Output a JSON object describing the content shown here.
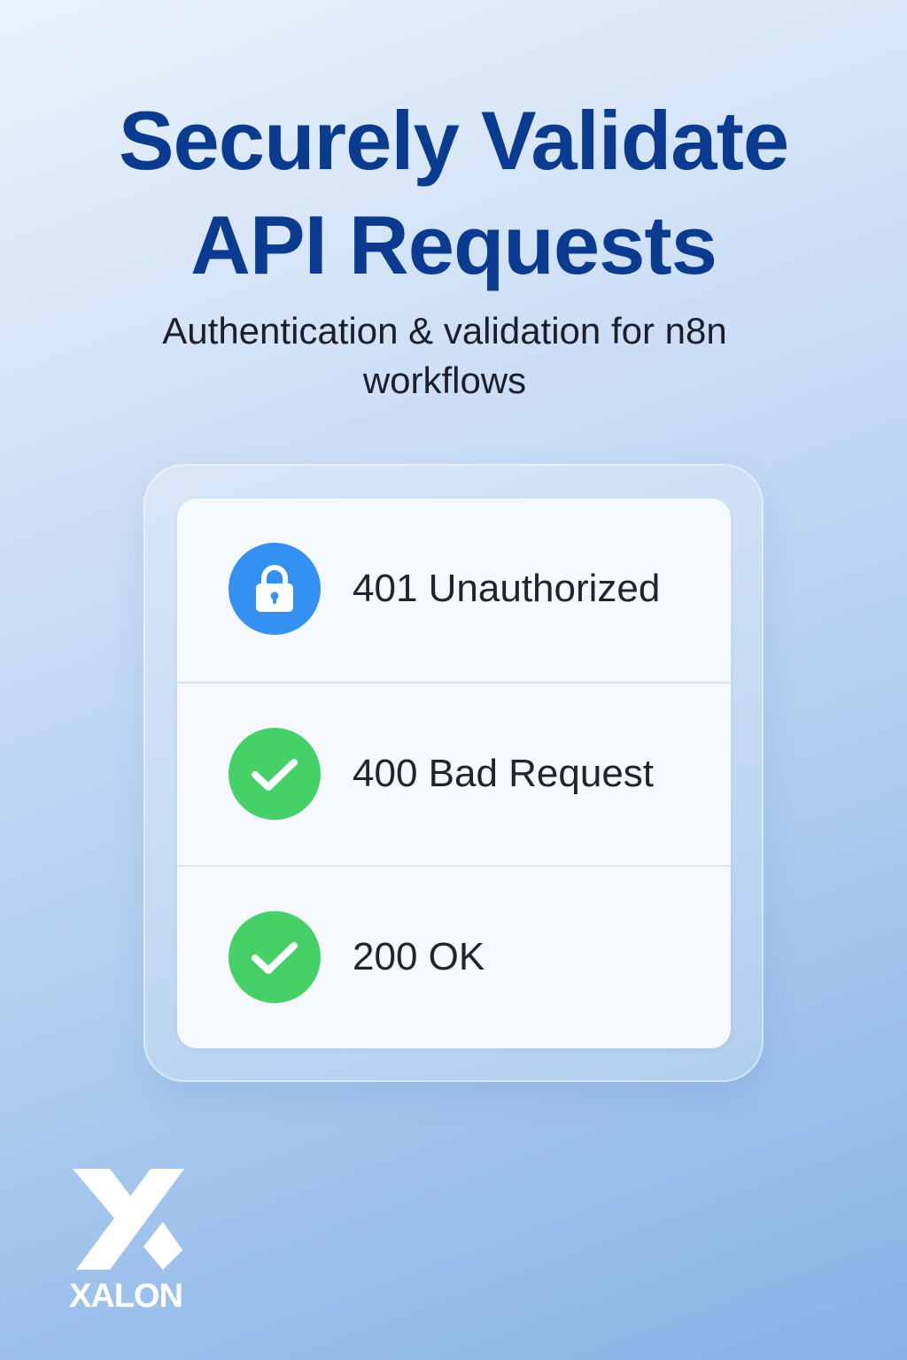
{
  "hero": {
    "title_line1": "Securely Validate",
    "title_line2": "API Requests",
    "subtitle": "Authentication & validation for n8n workflows"
  },
  "status_list": [
    {
      "label": "401 Unauthorized",
      "icon": "lock-icon",
      "color": "#3591f1"
    },
    {
      "label": "400 Bad Request",
      "icon": "check-icon",
      "color": "#46d168"
    },
    {
      "label": "200 OK",
      "icon": "check-icon",
      "color": "#46d168"
    }
  ],
  "brand": {
    "name": "XALON",
    "logo": "x-logo-icon"
  },
  "colors": {
    "title": "#0b3b91",
    "background_top": "#e8f2fc",
    "background_bottom": "#86b2e6"
  }
}
